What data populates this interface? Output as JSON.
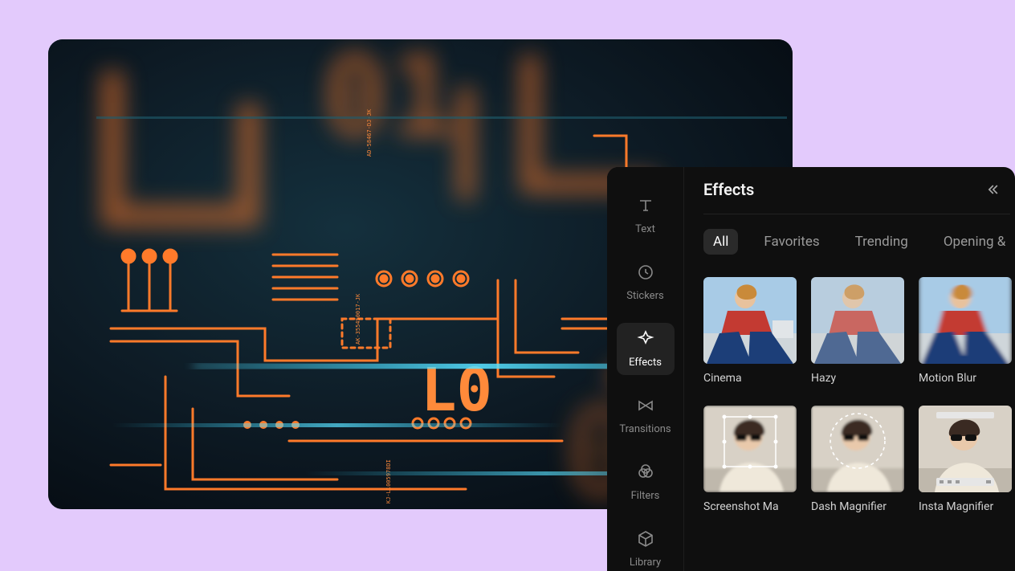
{
  "sidebar": {
    "items": [
      {
        "label": "Text",
        "icon": "text-icon"
      },
      {
        "label": "Stickers",
        "icon": "clock-icon"
      },
      {
        "label": "Effects",
        "icon": "sparkle-icon",
        "active": true
      },
      {
        "label": "Transitions",
        "icon": "bowtie-icon"
      },
      {
        "label": "Filters",
        "icon": "overlap-icon"
      },
      {
        "label": "Library",
        "icon": "cube-icon"
      }
    ]
  },
  "panel": {
    "title": "Effects",
    "tabs": [
      "All",
      "Favorites",
      "Trending",
      "Opening &"
    ],
    "active_tab": "All"
  },
  "effects": [
    {
      "label": "Cinema"
    },
    {
      "label": "Hazy"
    },
    {
      "label": "Motion Blur"
    },
    {
      "label": "Screenshot Ma"
    },
    {
      "label": "Dash Magnifier"
    },
    {
      "label": "Insta Magnifier"
    }
  ]
}
